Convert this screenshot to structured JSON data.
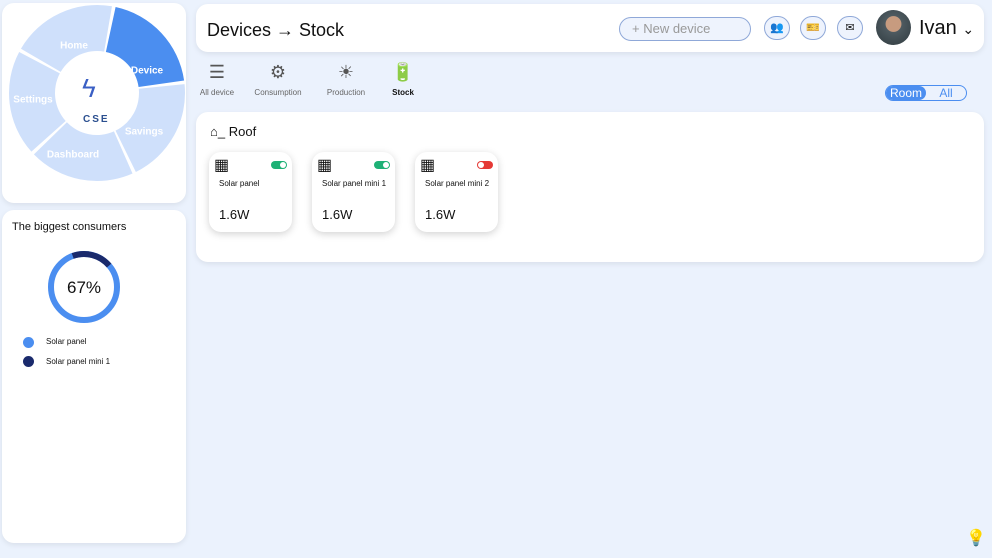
{
  "nav": {
    "logo": "CSE",
    "items": [
      {
        "label": "Home"
      },
      {
        "label": "Device",
        "active": true
      },
      {
        "label": "Savings"
      },
      {
        "label": "Dashboard"
      },
      {
        "label": "Settings"
      }
    ],
    "colors": {
      "segment": "#cfe0fb",
      "active": "#4b8ef0"
    }
  },
  "consumers": {
    "title": "The biggest consumers",
    "center_label": "67%",
    "legend": [
      {
        "label": "Solar panel",
        "color": "#4b8ef0"
      },
      {
        "label": "Solar panel mini 1",
        "color": "#1a2a6c"
      }
    ]
  },
  "header": {
    "breadcrumb": "Devices → Stock",
    "new_device": "+ New device",
    "icons": [
      "people-icon",
      "offer-icon",
      "mail-icon"
    ],
    "user": "Ivan",
    "chevron": "⌄"
  },
  "tabs": [
    {
      "label": "All device",
      "icon": "☰"
    },
    {
      "label": "Consumption",
      "icon": "⚙"
    },
    {
      "label": "Production",
      "icon": "☀"
    },
    {
      "label": "Stock",
      "icon": "🔋",
      "active": true
    }
  ],
  "filter": {
    "options": [
      "Room",
      "All"
    ],
    "selected": "Room"
  },
  "room": {
    "title": "Roof",
    "devices": [
      {
        "name": "Solar panel",
        "power": "1.6W",
        "on": true
      },
      {
        "name": "Solar panel mini 1",
        "power": "1.6W",
        "on": true
      },
      {
        "name": "Solar panel mini 2",
        "power": "1.6W",
        "on": false
      }
    ]
  }
}
